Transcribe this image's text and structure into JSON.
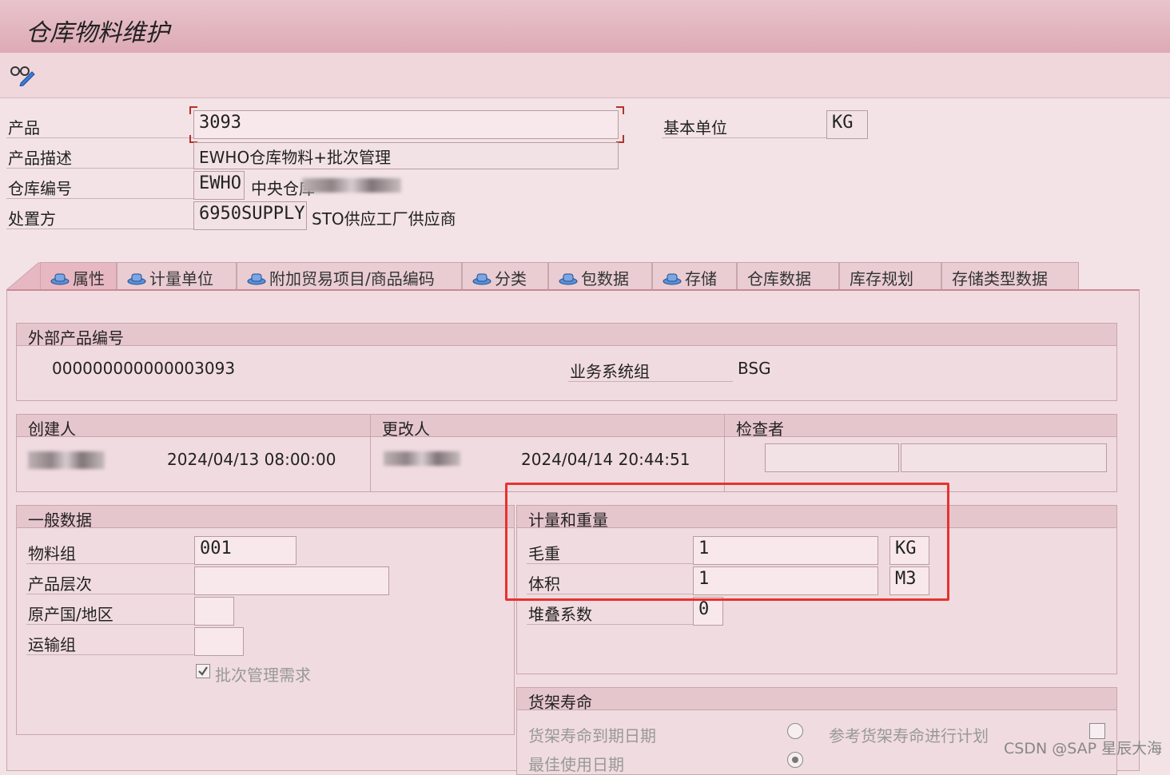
{
  "window": {
    "title": "仓库物料维护"
  },
  "toolbar": {
    "icon": "glasses-edit-icon"
  },
  "header": {
    "product_label": "产品",
    "product_value": "3093",
    "base_unit_label": "基本单位",
    "base_unit_value": "KG",
    "desc_label": "产品描述",
    "desc_value": "EWHO仓库物料+批次管理",
    "warehouse_label": "仓库编号",
    "warehouse_code": "EWHO",
    "warehouse_name": "中央仓库",
    "party_label": "处置方",
    "party_code": "6950SUPPLY",
    "party_name": "STO供应工厂供应商"
  },
  "tabs": [
    {
      "label": "属性",
      "icon": "hat-icon",
      "active": true
    },
    {
      "label": "计量单位",
      "icon": "hat-icon"
    },
    {
      "label": "附加贸易项目/商品编码",
      "icon": "hat-icon"
    },
    {
      "label": "分类",
      "icon": "hat-icon"
    },
    {
      "label": "包数据",
      "icon": "hat-icon"
    },
    {
      "label": "存储",
      "icon": "hat-icon"
    },
    {
      "label": "仓库数据"
    },
    {
      "label": "库存规划"
    },
    {
      "label": "存储类型数据"
    }
  ],
  "external": {
    "title": "外部产品编号",
    "number": "000000000000003093",
    "bsg_label": "业务系统组",
    "bsg_value": "BSG"
  },
  "created": {
    "title": "创建人",
    "timestamp": "2024/04/13 08:00:00"
  },
  "changed": {
    "title": "更改人",
    "timestamp": "2024/04/14 20:44:51"
  },
  "checker": {
    "title": "检查者"
  },
  "general": {
    "title": "一般数据",
    "material_group_label": "物料组",
    "material_group_value": "001",
    "hierarchy_label": "产品层次",
    "country_label": "原产国/地区",
    "transport_label": "运输组",
    "batch_label": "批次管理需求",
    "batch_checked": true
  },
  "measure": {
    "title": "计量和重量",
    "gross_label": "毛重",
    "gross_value": "1",
    "gross_unit": "KG",
    "volume_label": "体积",
    "volume_value": "1",
    "volume_unit": "M3",
    "stack_label": "堆叠系数",
    "stack_value": "0"
  },
  "shelf": {
    "title": "货架寿命",
    "expiry_label": "货架寿命到期日期",
    "plan_label": "参考货架寿命进行计划",
    "best_before_label": "最佳使用日期"
  },
  "watermark": "CSDN @SAP 星辰大海",
  "colors": {
    "highlight_box": "#e8322f",
    "title_bar": "#ddaab5"
  }
}
